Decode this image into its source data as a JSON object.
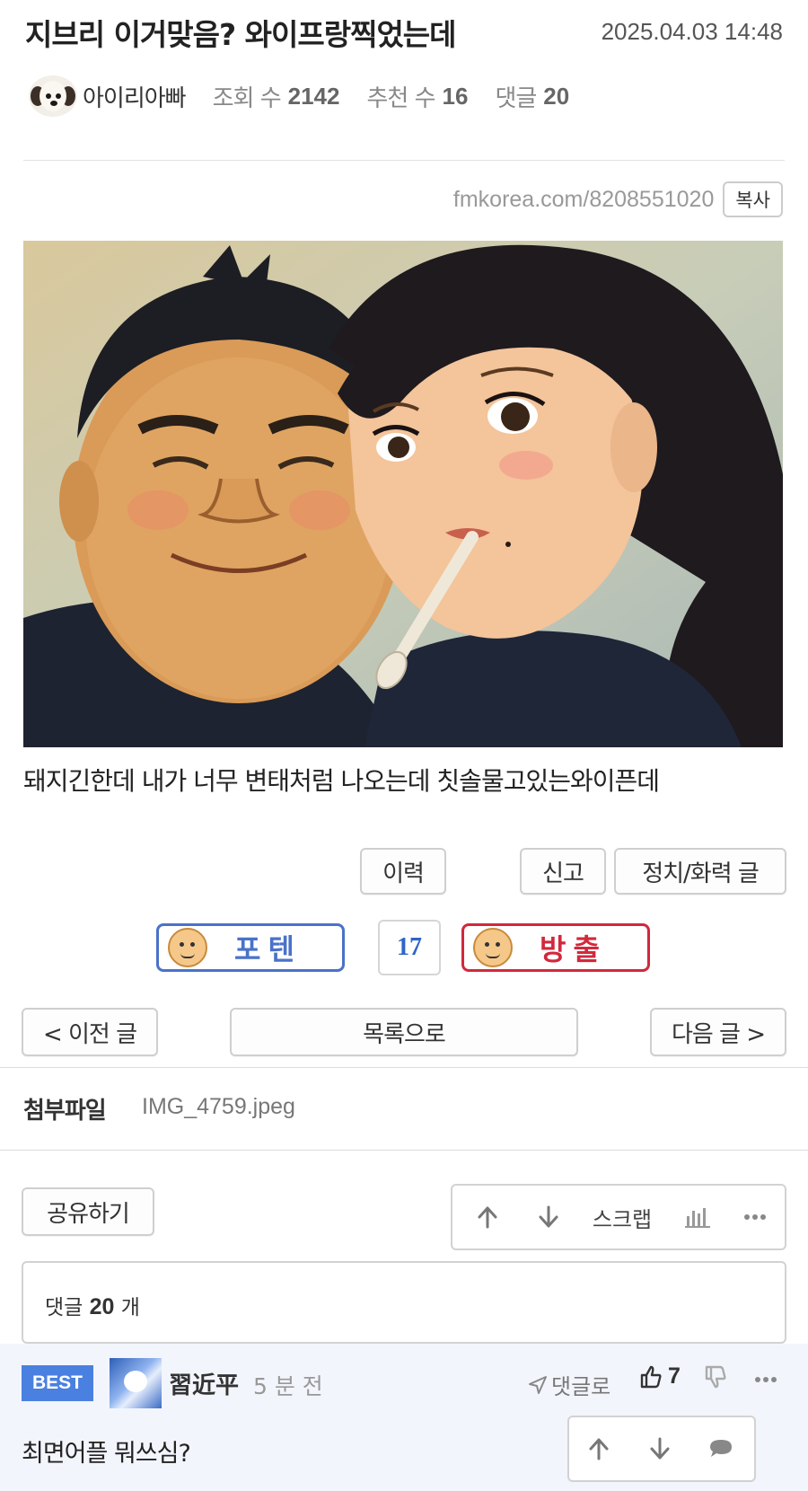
{
  "post": {
    "title": "지브리 이거맞음? 와이프랑찍었는데",
    "date": "2025.04.03 14:48",
    "author": "아이리아빠",
    "views_label": "조회 수",
    "views": "2142",
    "recommend_label": "추천 수",
    "recommend": "16",
    "comments_label": "댓글",
    "comments": "20",
    "url": "fmkorea.com/8208551020",
    "copy_label": "복사",
    "caption": "돼지긴한데 내가 너무 변태처럼 나오는데 칫솔물고있는와이픈데"
  },
  "actions": {
    "history": "이력",
    "report": "신고",
    "category": "정치/화력 글"
  },
  "vote": {
    "up_label": "포텐",
    "count": "17",
    "down_label": "방출",
    "up_color": "#4a72c8",
    "down_color": "#d2283c"
  },
  "nav": {
    "prev": "< 이전 글",
    "list": "목록으로",
    "next": "다음 글 >"
  },
  "attachment": {
    "label": "첨부파일",
    "file": "IMG_4759.jpeg"
  },
  "share_label": "공유하기",
  "toolbar": {
    "scrap": "스크랩",
    "up_icon": "arrow-up-icon",
    "down_icon": "arrow-down-icon",
    "stats_icon": "bar-chart-icon",
    "more_icon": "more-icon"
  },
  "comment_header": {
    "label": "댓글",
    "count": "20",
    "unit": "개"
  },
  "best_comment": {
    "badge": "BEST",
    "author": "習近平",
    "time": "5 분 전",
    "reply_label": "댓글로",
    "likes": "7",
    "text": "최면어플 뭐쓰심?"
  }
}
